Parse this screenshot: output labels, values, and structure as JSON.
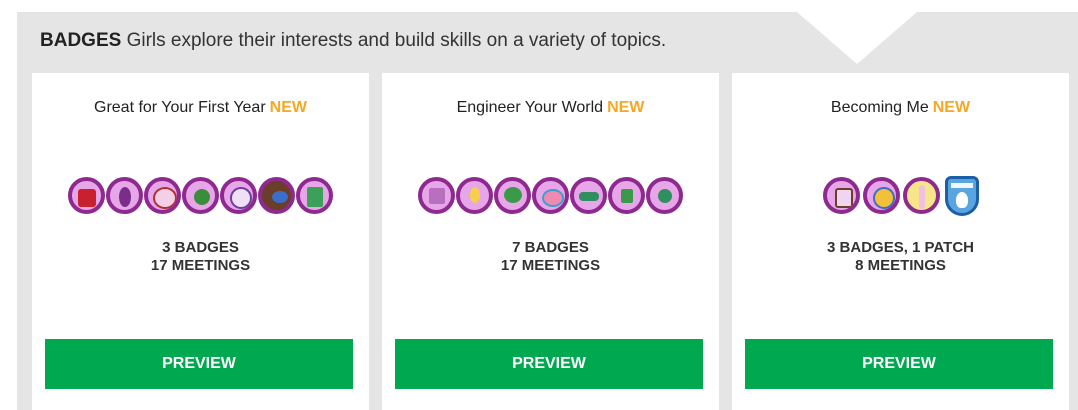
{
  "header": {
    "title": "BADGES",
    "subtitle": "Girls explore their interests and build skills on a variety of topics."
  },
  "cards": [
    {
      "title": "Great for Your First Year",
      "new_label": "NEW",
      "stats_line1": "3 BADGES",
      "stats_line2": "17 MEETINGS",
      "button_label": "PREVIEW",
      "badge_icons": [
        "gift-badge-icon",
        "horse-badge-icon",
        "ball-badge-icon",
        "globe-badge-icon",
        "clock-badge-icon",
        "bird-badge-icon",
        "map-badge-icon"
      ]
    },
    {
      "title": "Engineer Your World",
      "new_label": "NEW",
      "stats_line1": "7 BADGES",
      "stats_line2": "17 MEETINGS",
      "button_label": "PREVIEW",
      "badge_icons": [
        "grid-badge-icon",
        "lightbulb-badge-icon",
        "tree-badge-icon",
        "bridge-badge-icon",
        "car-badge-icon",
        "house-badge-icon",
        "gem-badge-icon"
      ]
    },
    {
      "title": "Becoming Me",
      "new_label": "NEW",
      "stats_line1": "3 BADGES, 1 PATCH",
      "stats_line2": "8 MEETINGS",
      "button_label": "PREVIEW",
      "badge_icons": [
        "scales-badge-icon",
        "compass-badge-icon",
        "feather-badge-icon"
      ],
      "patch_icon": "becoming-me-patch-icon"
    }
  ],
  "colors": {
    "accent_new": "#f7a823",
    "button_green": "#00a94f",
    "badge_border": "#8e2a8f",
    "panel_bg": "#e5e5e5"
  }
}
